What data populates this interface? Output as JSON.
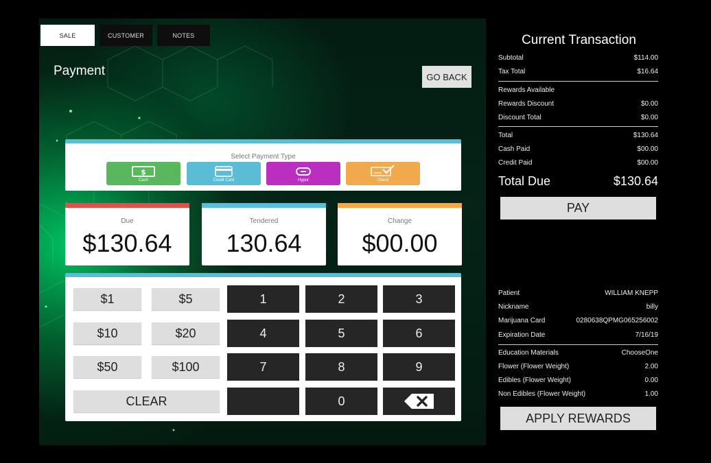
{
  "tabs": [
    "SALE",
    "CUSTOMER",
    "NOTES"
  ],
  "page_title": "Payment",
  "go_back_label": "GO BACK",
  "payment_type": {
    "title": "Select Payment Type",
    "options": [
      {
        "label": "Cash",
        "color": "#59b85e",
        "icon": "cash-icon"
      },
      {
        "label": "Credit Card",
        "color": "#5bbcd6",
        "icon": "credit-card-icon"
      },
      {
        "label": "Hypur",
        "color": "#bb2fc0",
        "icon": "link-icon"
      },
      {
        "label": "Check",
        "color": "#f0a94c",
        "icon": "check-icon"
      }
    ]
  },
  "amounts": {
    "due": {
      "label": "Due",
      "value": "$130.64",
      "color": "#d9534f"
    },
    "tendered": {
      "label": "Tendered",
      "value": "130.64",
      "color": "#5bbcd6"
    },
    "change": {
      "label": "Change",
      "value": "$00.00",
      "color": "#f0a94c"
    }
  },
  "quick_amounts": [
    "$1",
    "$5",
    "$10",
    "$20",
    "$50",
    "$100"
  ],
  "clear_label": "CLEAR",
  "digits": [
    "1",
    "2",
    "3",
    "4",
    "5",
    "6",
    "7",
    "8",
    "9",
    "0"
  ],
  "transaction": {
    "title": "Current Transaction",
    "subtotal": {
      "label": "Subtotal",
      "value": "$114.00"
    },
    "tax_total": {
      "label": "Tax Total",
      "value": "$16.64"
    },
    "rewards_available": {
      "label": "Rewards Available",
      "value": ""
    },
    "rewards_discount": {
      "label": "Rewards Discount",
      "value": "$0.00"
    },
    "discount_total": {
      "label": "Discount Total",
      "value": "$0.00"
    },
    "total": {
      "label": "Total",
      "value": "$130.64"
    },
    "cash_paid": {
      "label": "Cash Paid",
      "value": "$00.00"
    },
    "credit_paid": {
      "label": "Credit Paid",
      "value": "$00.00"
    },
    "total_due": {
      "label": "Total Due",
      "value": "$130.64"
    },
    "pay_label": "PAY"
  },
  "patient": {
    "patient": {
      "label": "Patient",
      "value": "WILLIAM KNEPP"
    },
    "nickname": {
      "label": "Nickname",
      "value": "billy"
    },
    "card": {
      "label": "Marijuana Card",
      "value": "0280638QPMG065256002"
    },
    "expiration": {
      "label": "Expiration Date",
      "value": "7/16/19"
    },
    "education": {
      "label": "Education Materials",
      "value": "ChooseOne"
    },
    "flower": {
      "label": "Flower (Flower Weight)",
      "value": "2.00"
    },
    "edibles": {
      "label": "Edibles (Flower Weight)",
      "value": "0.00"
    },
    "non_edibles": {
      "label": "Non Edibles (Flower Weight)",
      "value": "1.00"
    },
    "apply_rewards_label": "APPLY REWARDS"
  }
}
